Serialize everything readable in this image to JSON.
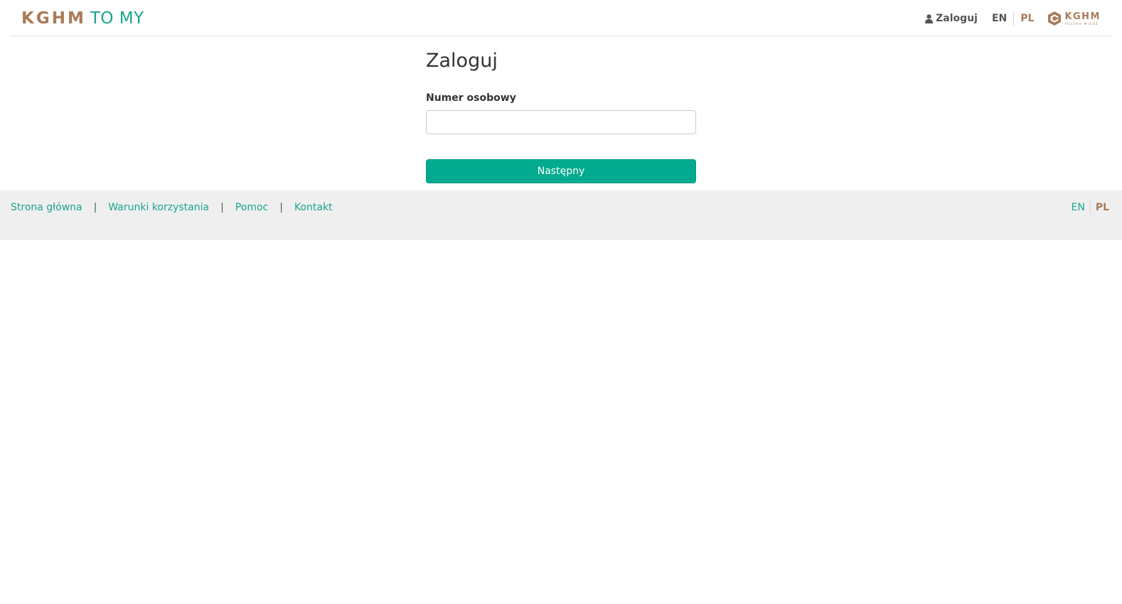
{
  "header": {
    "brand": {
      "kghm": "KGHM",
      "tomy": "TO MY"
    },
    "login_label": "Zaloguj",
    "languages": [
      "EN",
      "PL"
    ],
    "active_language": "PL",
    "corp_logo": {
      "name": "KGHM",
      "subtitle": "POLSKA MIEDŹ"
    }
  },
  "form": {
    "title": "Zaloguj",
    "field_label": "Numer osobowy",
    "field_value": "",
    "field_placeholder": "",
    "submit_label": "Następny"
  },
  "footer": {
    "links": [
      "Strona główna",
      "Warunki korzystania",
      "Pomoc",
      "Kontakt"
    ],
    "separator": "|",
    "languages": [
      "EN",
      "PL"
    ]
  },
  "colors": {
    "brand_brown": "#a97b59",
    "brand_teal": "#1aa58d",
    "button_green": "#02ab8f",
    "footer_bg": "#efefef"
  },
  "icons": [
    "user-icon",
    "kghm-logo-icon"
  ]
}
